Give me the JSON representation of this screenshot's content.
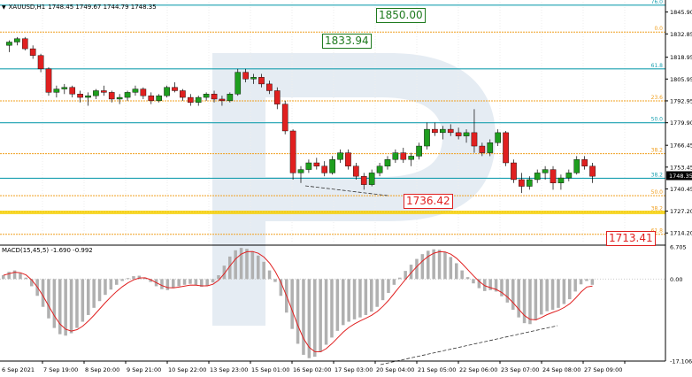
{
  "header": {
    "symbol": "XAUUSD,H1",
    "ohlc": "1748.45 1749.67 1744.79 1748.35"
  },
  "price_axis": {
    "ticks": [
      "1845.90",
      "1832.85",
      "1818.95",
      "1805.95",
      "1792.95",
      "1779.90",
      "1766.45",
      "1753.45",
      "1740.45",
      "1727.20",
      "1714.20"
    ],
    "current_price": "1748.35"
  },
  "fib_labels": [
    "76.0",
    "0.0",
    "61.8",
    "23.6",
    "50.0",
    "38.2",
    "38.2",
    "50.0",
    "38.2",
    "61.8"
  ],
  "annotations": {
    "a1": "1850.00",
    "a2": "1833.94",
    "a3": "1736.42",
    "a4": "1713.41"
  },
  "macd": {
    "label": "MACD(15,45,5) -1.690 -0.992",
    "ticks": [
      "6.705",
      "0.00",
      "-17.106"
    ]
  },
  "time_axis": [
    "6 Sep 2021",
    "7 Sep 19:00",
    "8 Sep 20:00",
    "9 Sep 21:00",
    "10 Sep 22:00",
    "13 Sep 23:00",
    "15 Sep 01:00",
    "16 Sep 02:00",
    "17 Sep 03:00",
    "20 Sep 04:00",
    "21 Sep 05:00",
    "22 Sep 06:00",
    "23 Sep 07:00",
    "24 Sep 08:00",
    "27 Sep 09:00"
  ],
  "colors": {
    "up": "#1e9e1e",
    "down": "#e02020",
    "fib_main": "#1aa0b0",
    "fib_alt": "#f0a020",
    "macd_hist": "#b0b0b0",
    "macd_signal": "#e02020"
  },
  "chart_data": {
    "type": "candlestick",
    "price_range": [
      1708,
      1852
    ],
    "candles": [
      [
        1826,
        1829,
        1822,
        1828
      ],
      [
        1828,
        1831,
        1826,
        1830
      ],
      [
        1830,
        1831,
        1823,
        1824
      ],
      [
        1824,
        1826,
        1818,
        1820
      ],
      [
        1820,
        1821,
        1810,
        1812
      ],
      [
        1812,
        1813,
        1796,
        1798
      ],
      [
        1798,
        1802,
        1795,
        1800
      ],
      [
        1800,
        1803,
        1797,
        1801
      ],
      [
        1801,
        1802,
        1795,
        1797
      ],
      [
        1797,
        1799,
        1792,
        1795
      ],
      [
        1795,
        1798,
        1790,
        1796
      ],
      [
        1796,
        1800,
        1794,
        1799
      ],
      [
        1799,
        1802,
        1796,
        1798
      ],
      [
        1798,
        1799,
        1792,
        1794
      ],
      [
        1794,
        1797,
        1791,
        1795
      ],
      [
        1795,
        1799,
        1793,
        1798
      ],
      [
        1798,
        1802,
        1796,
        1800
      ],
      [
        1800,
        1801,
        1794,
        1796
      ],
      [
        1796,
        1798,
        1791,
        1793
      ],
      [
        1793,
        1797,
        1792,
        1796
      ],
      [
        1796,
        1802,
        1795,
        1801
      ],
      [
        1801,
        1804,
        1798,
        1799
      ],
      [
        1799,
        1800,
        1793,
        1795
      ],
      [
        1795,
        1797,
        1790,
        1792
      ],
      [
        1792,
        1796,
        1790,
        1795
      ],
      [
        1795,
        1798,
        1793,
        1797
      ],
      [
        1797,
        1799,
        1792,
        1794
      ],
      [
        1794,
        1796,
        1790,
        1793
      ],
      [
        1793,
        1798,
        1792,
        1797
      ],
      [
        1797,
        1812,
        1796,
        1810
      ],
      [
        1810,
        1812,
        1804,
        1806
      ],
      [
        1806,
        1809,
        1803,
        1807
      ],
      [
        1807,
        1809,
        1801,
        1803
      ],
      [
        1803,
        1805,
        1797,
        1799
      ],
      [
        1799,
        1801,
        1788,
        1791
      ],
      [
        1791,
        1793,
        1773,
        1775
      ],
      [
        1775,
        1776,
        1746,
        1750
      ],
      [
        1750,
        1754,
        1744,
        1752
      ],
      [
        1752,
        1758,
        1750,
        1756
      ],
      [
        1756,
        1759,
        1752,
        1754
      ],
      [
        1754,
        1757,
        1748,
        1750
      ],
      [
        1750,
        1760,
        1749,
        1758
      ],
      [
        1758,
        1764,
        1756,
        1762
      ],
      [
        1762,
        1764,
        1752,
        1754
      ],
      [
        1754,
        1756,
        1746,
        1748
      ],
      [
        1748,
        1750,
        1740,
        1743
      ],
      [
        1743,
        1752,
        1742,
        1750
      ],
      [
        1750,
        1756,
        1748,
        1754
      ],
      [
        1754,
        1760,
        1752,
        1758
      ],
      [
        1758,
        1764,
        1756,
        1762
      ],
      [
        1762,
        1765,
        1756,
        1758
      ],
      [
        1758,
        1762,
        1754,
        1760
      ],
      [
        1760,
        1768,
        1758,
        1766
      ],
      [
        1766,
        1780,
        1764,
        1776
      ],
      [
        1776,
        1780,
        1772,
        1774
      ],
      [
        1774,
        1778,
        1770,
        1776
      ],
      [
        1776,
        1779,
        1772,
        1774
      ],
      [
        1774,
        1777,
        1770,
        1772
      ],
      [
        1772,
        1776,
        1768,
        1774
      ],
      [
        1774,
        1788,
        1762,
        1766
      ],
      [
        1766,
        1768,
        1760,
        1762
      ],
      [
        1762,
        1770,
        1760,
        1768
      ],
      [
        1768,
        1776,
        1766,
        1774
      ],
      [
        1774,
        1775,
        1754,
        1756
      ],
      [
        1756,
        1758,
        1744,
        1746
      ],
      [
        1746,
        1750,
        1738,
        1742
      ],
      [
        1742,
        1748,
        1740,
        1746
      ],
      [
        1746,
        1752,
        1744,
        1750
      ],
      [
        1750,
        1754,
        1746,
        1752
      ],
      [
        1752,
        1754,
        1740,
        1744
      ],
      [
        1744,
        1749,
        1740,
        1747
      ],
      [
        1747,
        1752,
        1745,
        1750
      ],
      [
        1750,
        1760,
        1749,
        1758
      ],
      [
        1758,
        1760,
        1752,
        1754
      ],
      [
        1754,
        1756,
        1744,
        1748
      ]
    ],
    "fib_levels": [
      {
        "price": 1850.0,
        "color": "main"
      },
      {
        "price": 1833.94,
        "color": "alt"
      },
      {
        "price": 1812.0,
        "color": "main"
      },
      {
        "price": 1792.95,
        "color": "alt"
      },
      {
        "price": 1779.9,
        "color": "main"
      },
      {
        "price": 1761.5,
        "color": "alt"
      },
      {
        "price": 1746.8,
        "color": "main"
      },
      {
        "price": 1736.42,
        "color": "alt"
      },
      {
        "price": 1726.8,
        "color": "alt"
      },
      {
        "price": 1713.41,
        "color": "alt"
      }
    ],
    "macd_range": [
      -17.106,
      6.705
    ],
    "macd_hist": [
      0.8,
      1.5,
      1.8,
      1.2,
      0.3,
      -1.5,
      -3.5,
      -5.8,
      -8.2,
      -10.2,
      -11.5,
      -11.8,
      -11.3,
      -10.2,
      -8.9,
      -7.5,
      -6.0,
      -4.6,
      -3.3,
      -2.2,
      -1.2,
      -0.4,
      0.2,
      0.6,
      0.7,
      0.3,
      -0.6,
      -1.5,
      -2.1,
      -2.3,
      -1.9,
      -1.5,
      -1.2,
      -1.0,
      -1.3,
      -1.6,
      -1.4,
      -0.7,
      0.8,
      2.8,
      4.7,
      6.0,
      6.5,
      6.3,
      5.8,
      4.9,
      3.6,
      1.8,
      -0.6,
      -3.5,
      -7.0,
      -10.4,
      -13.5,
      -15.8,
      -16.5,
      -16.2,
      -15.2,
      -13.7,
      -12.2,
      -10.8,
      -9.6,
      -8.9,
      -8.4,
      -8.0,
      -7.5,
      -6.8,
      -5.8,
      -4.4,
      -2.9,
      -1.2,
      0.3,
      1.7,
      3.0,
      4.2,
      5.2,
      5.9,
      6.2,
      6.1,
      5.6,
      4.6,
      3.3,
      1.8,
      0.4,
      -0.9,
      -1.9,
      -2.5,
      -2.3,
      -2.6,
      -3.6,
      -4.9,
      -6.4,
      -8.0,
      -9.2,
      -9.4,
      -8.6,
      -7.4,
      -6.7,
      -6.4,
      -6.0,
      -5.2,
      -4.2,
      -2.6,
      -1.1,
      -0.4,
      -1.2
    ]
  }
}
